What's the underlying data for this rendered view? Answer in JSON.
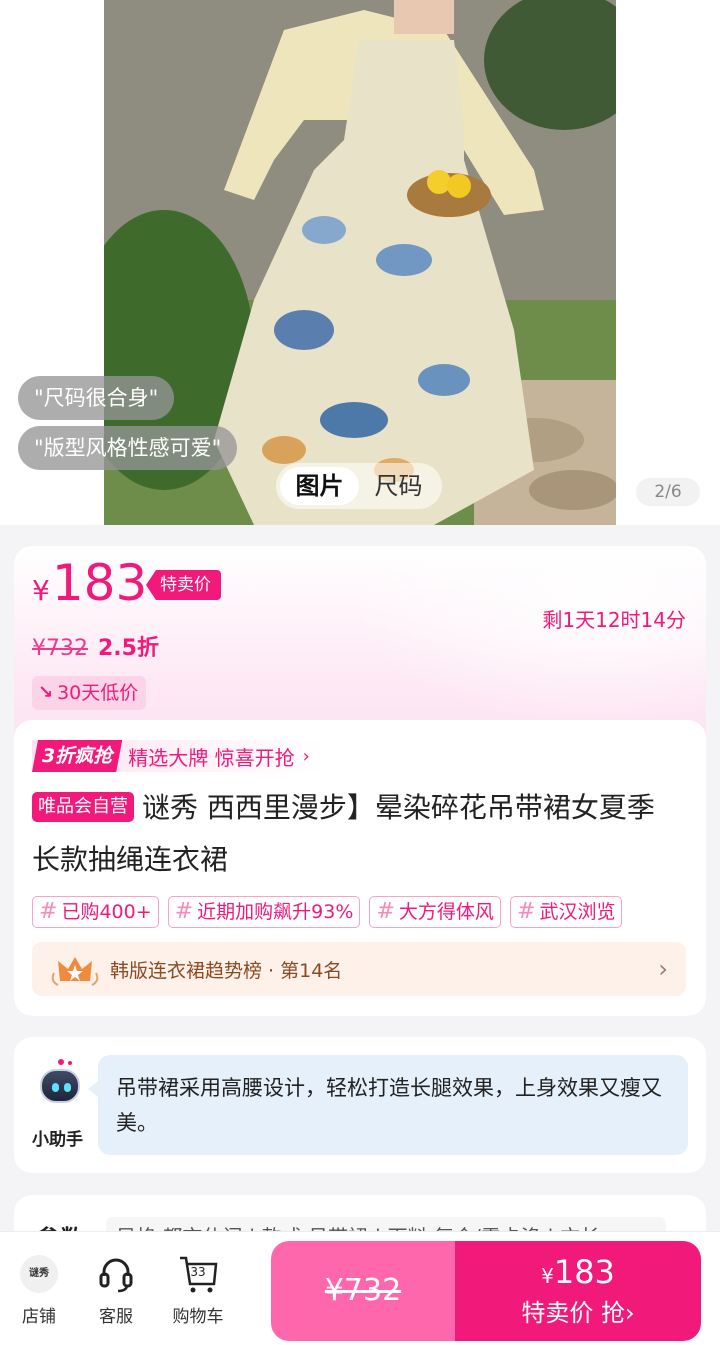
{
  "hero": {
    "reviews": [
      "\"尺码很合身\"",
      "\"版型风格性感可爱\""
    ],
    "tabs": [
      "图片",
      "尺码"
    ],
    "active_tab": "图片",
    "pager": "2/6"
  },
  "price": {
    "currency": "¥",
    "current": "183",
    "tag": "特卖价",
    "countdown": "剩1天12时14分",
    "original": "¥732",
    "discount": "2.5折",
    "low_price_badge": "30天低价"
  },
  "promo": {
    "badge": "3折疯抢",
    "text": "精选大牌 惊喜开抢",
    "chevron": "›"
  },
  "product": {
    "vip_tag": "唯品会自营",
    "title": "谜秀 西西里漫步】晕染碎花吊带裙女夏季长款抽绳连衣裙"
  },
  "hashtags": [
    "已购400+",
    "近期加购飙升93%",
    "大方得体风",
    "武汉浏览"
  ],
  "ranking": {
    "text": "韩版连衣裙趋势榜 · 第14名"
  },
  "assistant": {
    "label": "小助手",
    "message": "吊带裙采用高腰设计，轻松打造长腿效果，上身效果又瘦又美。"
  },
  "params": {
    "title": "参数",
    "summary": "风格 都市休闲 | 款式 吊带裙 | 面料 复合/雪卡涤 | 衣长"
  },
  "bottom_bar": {
    "shop_logo_text": "谜秀",
    "shop": "店铺",
    "service": "客服",
    "cart": "购物车",
    "cart_count": "33",
    "buy_original": "¥732",
    "buy_currency": "¥",
    "buy_price": "183",
    "buy_label": "特卖价 抢›"
  },
  "colors": {
    "accent": "#f1197a",
    "accent_light": "#ff67ad",
    "assistant_bubble": "#e6f0fb",
    "rank_bg": "#fdf1ea"
  }
}
